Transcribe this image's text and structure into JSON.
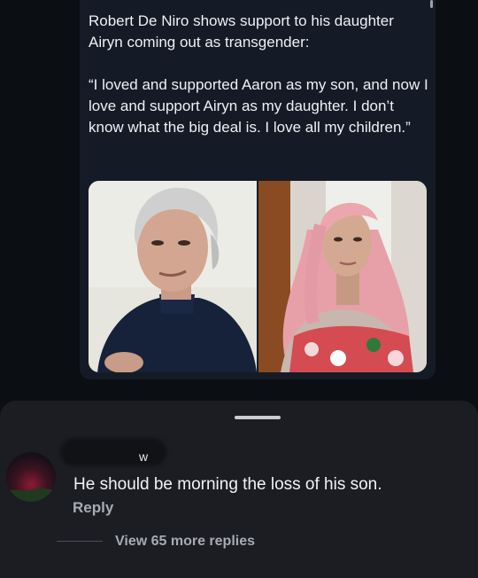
{
  "post": {
    "headline": "Robert De Niro shows support to his daughter Airyn coming out as transgender:",
    "quote": "“I loved and supported Aaron as my son, and now I love and support Airyn as my daughter. I don’t know what the big deal is. I love all my children.”",
    "images": [
      "man-portrait-photo",
      "woman-portrait-photo"
    ]
  },
  "comment": {
    "username_visible": "w",
    "text": "He should be morning the loss of his son.",
    "reply_label": "Reply",
    "view_replies_label": "View 65 more replies"
  },
  "colors": {
    "background": "#0b0e13",
    "card": "#151b26",
    "sheet": "#1b1d22",
    "muted_text": "#a7abb2"
  }
}
